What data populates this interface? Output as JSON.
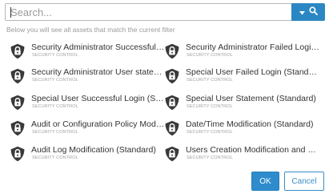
{
  "search": {
    "placeholder": "Search...",
    "value": ""
  },
  "helper_text": "Below you will see all assets that match the current filter",
  "items": [
    {
      "title": "Security Administrator Successful Lo...",
      "subtitle": "SECURITY CONTROL",
      "icon": "shield-lock-icon"
    },
    {
      "title": "Security Administrator Failed Login (...",
      "subtitle": "SECURITY CONTROL",
      "icon": "shield-lock-icon"
    },
    {
      "title": "Security Administrator User stateme...",
      "subtitle": "SECURITY CONTROL",
      "icon": "shield-lock-icon"
    },
    {
      "title": "Special User Failed Login (Standard)",
      "subtitle": "SECURITY CONTROL",
      "icon": "shield-lock-icon"
    },
    {
      "title": "Special User Successful Login (Stan...",
      "subtitle": "SECURITY CONTROL",
      "icon": "shield-lock-icon"
    },
    {
      "title": "Special User Statement (Standard)",
      "subtitle": "SECURITY CONTROL",
      "icon": "shield-lock-icon"
    },
    {
      "title": "Audit or Configuration Policy Modifi...",
      "subtitle": "SECURITY CONTROL",
      "icon": "shield-lock-icon"
    },
    {
      "title": "Date/Time Modification (Standard)",
      "subtitle": "SECURITY CONTROL",
      "icon": "shield-lock-icon"
    },
    {
      "title": "Audit Log Modification (Standard)",
      "subtitle": "SECURITY CONTROL",
      "icon": "shield-lock-icon"
    },
    {
      "title": "Users Creation Modification and Del...",
      "subtitle": "SECURITY CONTROL",
      "icon": "shield-lock-icon"
    }
  ],
  "buttons": {
    "ok": "OK",
    "cancel": "Cancel"
  },
  "colors": {
    "accent": "#2b87c3",
    "icon": "#3a3a3a"
  }
}
